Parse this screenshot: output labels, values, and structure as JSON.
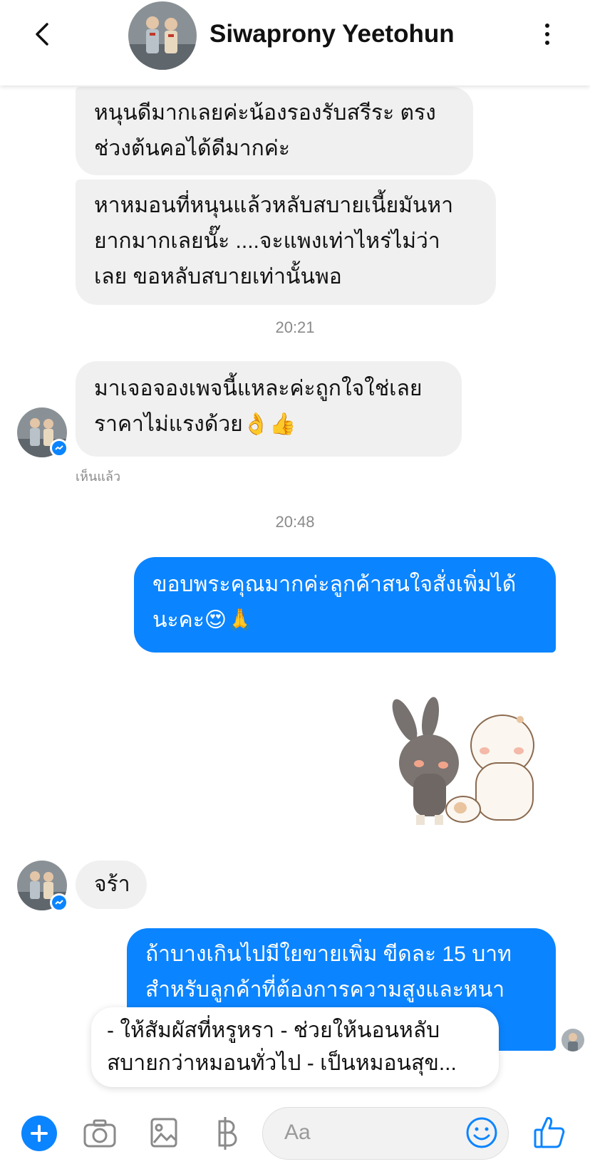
{
  "header": {
    "title": "Siwaprony Yeetohun"
  },
  "messages": [
    {
      "text": "หนุนดีมากเลยค่ะน้องรองรับสรีระ ตรง\nช่วงต้นคอได้ดีมากค่ะ"
    },
    {
      "text": "หาหมอนที่หนุนแล้วหลับสบายเนี้ยมันหา\nยากมากเลยนั๊ะ ....จะแพงเท่าไหร่ไม่ว่า\nเลย ขอหลับสบายเท่านั้นพอ"
    },
    {
      "time": "20:21"
    },
    {
      "text": "มาเจอจองเพจนี้แหละค่ะถูกใจใช่เลย\nราคาไม่แรงด้วย👌👍"
    },
    {
      "seen": "เห็นแล้ว"
    },
    {
      "time": "20:48"
    },
    {
      "text": "ขอบพระคุณมากค่ะลูกค้าสนใจสั่งเพิ่มได้\nนะคะ😍🙏"
    },
    {
      "text": "จร้า"
    },
    {
      "text": "ถ้าบางเกินไปมีใยขายเพิ่ม ขีดละ 15 บาท\nสำหรับลูกค้าที่ต้องการความสูงและหนา"
    }
  ],
  "preview": {
    "text": "- ให้สัมผัสที่หรูหรา - ช่วยให้นอนหลับ\nสบายกว่าหมอนทั่วไป - เป็นหมอนสุข..."
  },
  "composer": {
    "placeholder": "Aa"
  },
  "colors": {
    "outgoing": "#0b84ff",
    "incoming": "#f0f0f0"
  }
}
